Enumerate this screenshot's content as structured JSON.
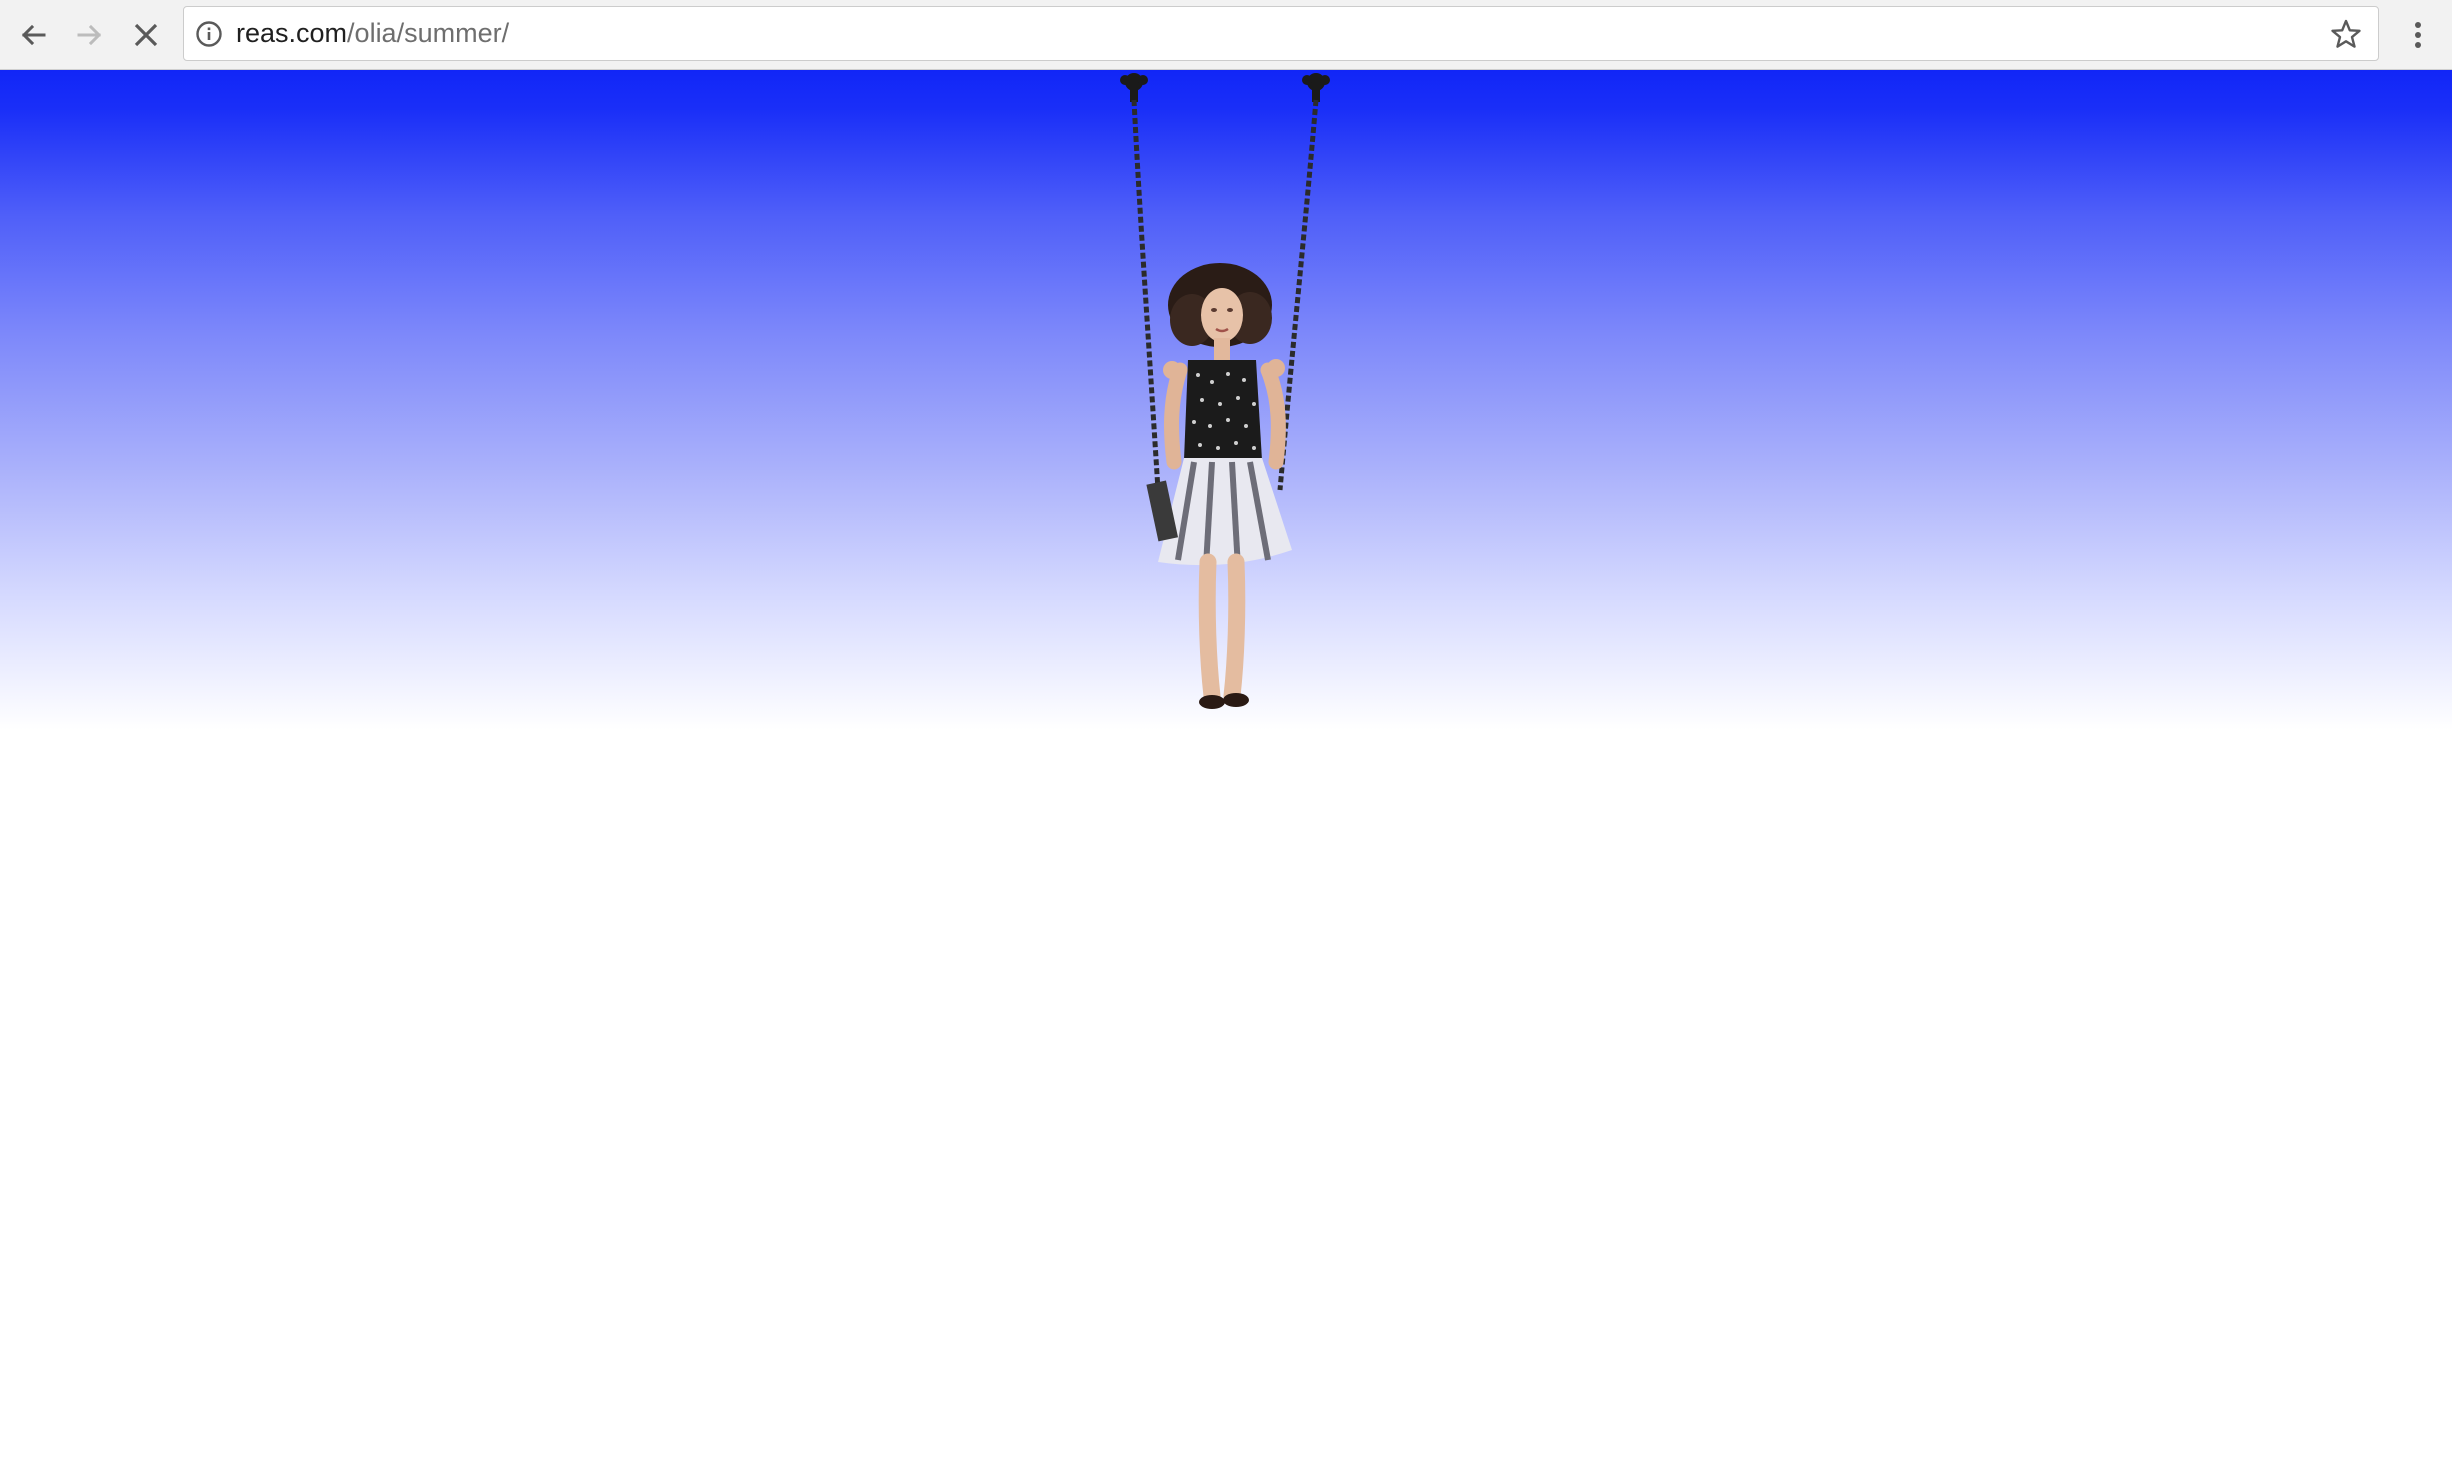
{
  "browser": {
    "url_host": "reas.com",
    "url_path": "/olia/summer/",
    "back_icon": "arrow-left-icon",
    "forward_icon": "arrow-right-icon",
    "stop_icon": "close-icon",
    "info_icon": "info-icon",
    "bookmark_icon": "star-icon",
    "menu_icon": "kebab-menu-icon",
    "forward_enabled": false,
    "loading": true
  },
  "page": {
    "sky_gradient_top": "#1126f7",
    "sky_gradient_bottom": "#ffffff",
    "image_subject_icon": "person-on-swing-image"
  }
}
